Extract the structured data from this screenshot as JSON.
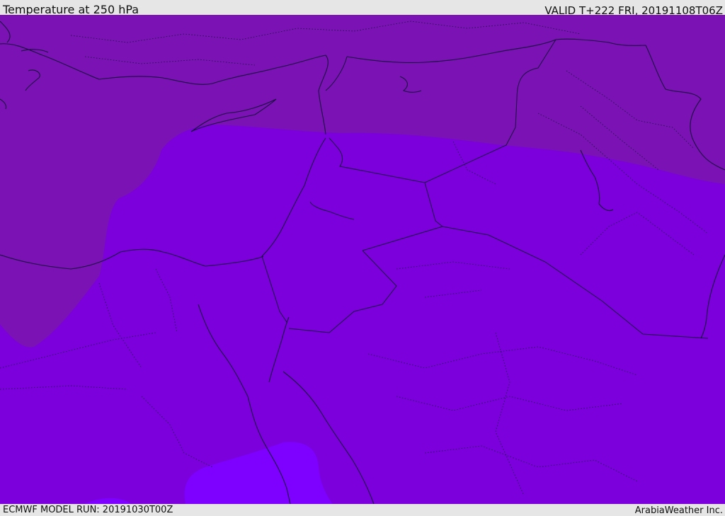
{
  "header": {
    "title": "Temperature at 250 hPa",
    "valid": "VALID T+222 FRI, 20191108T06Z"
  },
  "footer": {
    "model_run": "ECMWF MODEL RUN: 20191030T00Z",
    "credit": "ArabiaWeather Inc."
  },
  "map": {
    "colors": {
      "band_cold": "#7a12b4",
      "band_mid": "#7b00dc",
      "band_warm": "#7e00ff"
    }
  }
}
